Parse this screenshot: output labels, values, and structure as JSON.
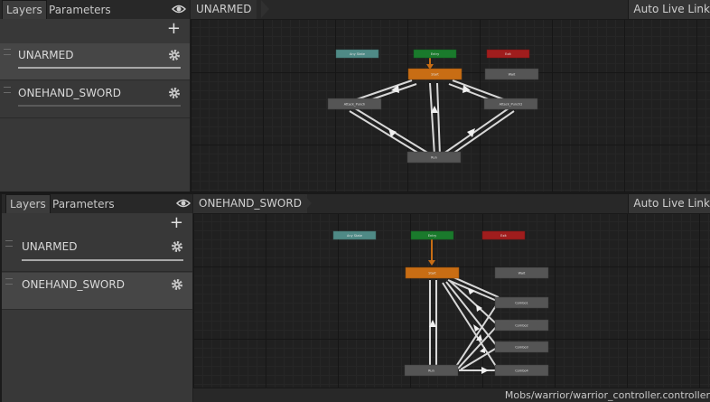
{
  "tabs": {
    "layers": "Layers",
    "parameters": "Parameters"
  },
  "top_panel": {
    "breadcrumb": "UNARMED",
    "auto_live_link": "Auto Live Link",
    "layers": [
      {
        "name": "UNARMED",
        "selected": true
      },
      {
        "name": "ONEHAND_SWORD",
        "selected": false
      }
    ],
    "nodes": {
      "any_state": "Any State",
      "entry": "Entry",
      "exit": "Exit",
      "start": "Start",
      "wait": "Wait",
      "attack_punch": "Attack_Punch",
      "attack_punch2": "Attack_Punch2",
      "run": "Run"
    }
  },
  "bottom_panel": {
    "breadcrumb": "ONEHAND_SWORD",
    "auto_live_link": "Auto Live Link",
    "layers": [
      {
        "name": "UNARMED",
        "selected": false
      },
      {
        "name": "ONEHAND_SWORD",
        "selected": true
      }
    ],
    "nodes": {
      "any_state": "Any State",
      "entry": "Entry",
      "exit": "Exit",
      "start": "Start",
      "wait": "Wait",
      "combo1": "Combo1",
      "combo2": "Combo2",
      "combo3": "Combo3",
      "combo4": "Combo4",
      "run": "Run"
    }
  },
  "status_path": "Mobs/warrior/warrior_controller.controller",
  "icons": {
    "eye": "eye-icon",
    "gear": "gear-icon",
    "plus": "plus-icon",
    "drag": "drag-handle-icon"
  },
  "colors": {
    "entry": "#1a7a2c",
    "exit": "#a01d1d",
    "any_state": "#4f8a86",
    "default_state": "#c86d14",
    "state": "#555555",
    "transition": "#d8d8d8"
  }
}
